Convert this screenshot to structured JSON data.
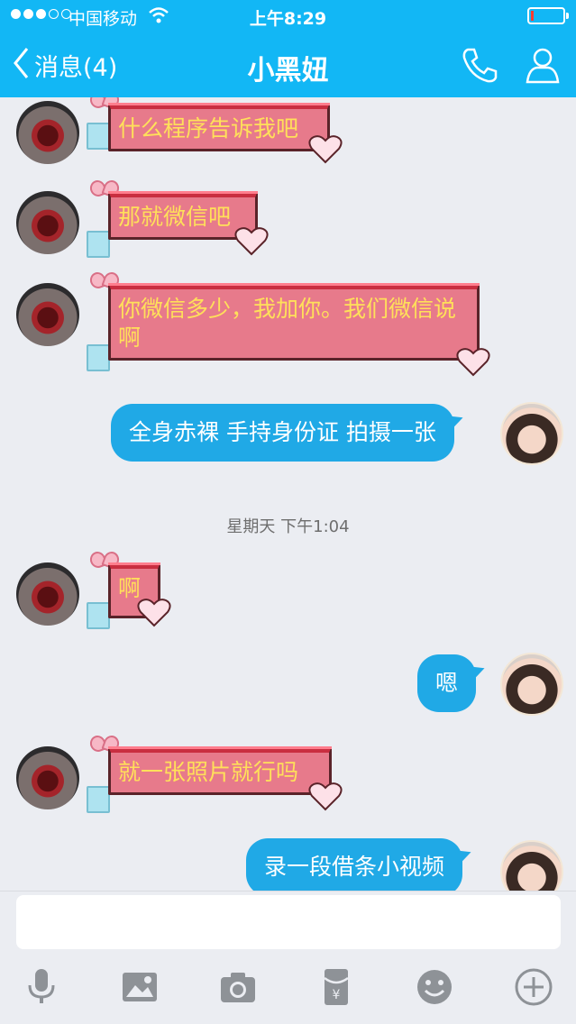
{
  "status_bar": {
    "carrier": "中国移动",
    "time": "上午8:29"
  },
  "nav": {
    "back_label": "消息(4)",
    "title": "小黑妞"
  },
  "messages": [
    {
      "side": "left",
      "text": "什么程序告诉我吧"
    },
    {
      "side": "left",
      "text": "那就微信吧"
    },
    {
      "side": "left",
      "text": "你微信多少，我加你。我们微信说啊"
    },
    {
      "side": "right",
      "text": "全身赤裸 手持身份证 拍摄一张"
    },
    {
      "side": "left",
      "text": "啊"
    },
    {
      "side": "right",
      "text": "嗯"
    },
    {
      "side": "left",
      "text": "就一张照片就行吗"
    },
    {
      "side": "right",
      "text": "录一段借条小视频"
    }
  ],
  "timestamp": "星期天 下午1:04",
  "input": {
    "value": "",
    "placeholder": ""
  },
  "toolbar": {
    "icons": [
      "microphone-icon",
      "image-icon",
      "camera-icon",
      "red-packet-icon",
      "emoji-icon",
      "plus-icon"
    ]
  },
  "colors": {
    "header": "#12b7f5",
    "sent_bubble": "#20a9e6",
    "gift_bubble": "#e77a8b",
    "gift_text": "#ffe05a",
    "background": "#ebedf2"
  }
}
